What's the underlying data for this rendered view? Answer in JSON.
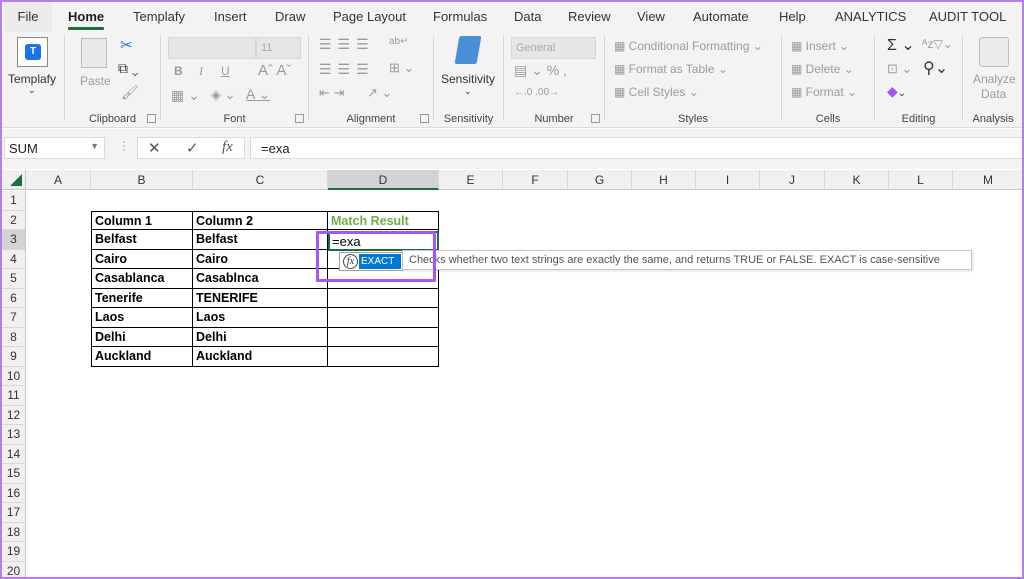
{
  "tabs": [
    "File",
    "Home",
    "Templafy",
    "Insert",
    "Draw",
    "Page Layout",
    "Formulas",
    "Data",
    "Review",
    "View",
    "Automate",
    "Help",
    "ANALYTICS",
    "AUDIT TOOL"
  ],
  "active_tab": "Home",
  "ribbon": {
    "templafy": {
      "label": "Templafy"
    },
    "clipboard": {
      "label": "Clipboard",
      "paste": "Paste"
    },
    "font": {
      "label": "Font",
      "font_size": "11",
      "bold": "B",
      "italic": "I",
      "underline": "U"
    },
    "alignment": {
      "label": "Alignment"
    },
    "sensitivity": {
      "label": "Sensitivity",
      "button": "Sensitivity"
    },
    "number": {
      "label": "Number",
      "format": "General"
    },
    "styles": {
      "label": "Styles",
      "conditional": "Conditional Formatting",
      "format_table": "Format as Table",
      "cell_styles": "Cell Styles"
    },
    "cells": {
      "label": "Cells",
      "insert": "Insert",
      "delete": "Delete",
      "format": "Format"
    },
    "editing": {
      "label": "Editing"
    },
    "analysis": {
      "label": "Analysis",
      "analyze_line1": "Analyze",
      "analyze_line2": "Data"
    }
  },
  "formula_bar": {
    "name_box": "SUM",
    "formula": "=exa"
  },
  "columns": [
    "A",
    "B",
    "C",
    "D",
    "E",
    "F",
    "G",
    "H",
    "I",
    "J",
    "K",
    "L",
    "M"
  ],
  "rows": [
    "1",
    "2",
    "3",
    "4",
    "5",
    "6",
    "7",
    "8",
    "9",
    "10",
    "11",
    "12",
    "13",
    "14",
    "15",
    "16",
    "17",
    "18",
    "19",
    "20"
  ],
  "table": {
    "headers": [
      "Column 1",
      "Column 2",
      "Match Result"
    ],
    "rows": [
      [
        "Belfast",
        "Belfast",
        ""
      ],
      [
        "Cairo",
        "Cairo",
        ""
      ],
      [
        "Casablanca",
        "Casablnca",
        ""
      ],
      [
        "Tenerife",
        "TENERIFE",
        ""
      ],
      [
        "Laos",
        "Laos",
        ""
      ],
      [
        "Delhi",
        "Delhi",
        ""
      ],
      [
        "Auckland",
        "Auckland",
        ""
      ]
    ]
  },
  "active_cell": {
    "ref": "D3",
    "value": "=exa"
  },
  "autocomplete": {
    "item": "EXACT",
    "tooltip": "Checks whether two text strings are exactly the same, and returns TRUE or FALSE. EXACT is case-sensitive"
  },
  "colors": {
    "accent": "#1d6b3f",
    "highlight": "#a855f7",
    "header_green": "#70ad47",
    "selection_blue": "#0078d4"
  }
}
